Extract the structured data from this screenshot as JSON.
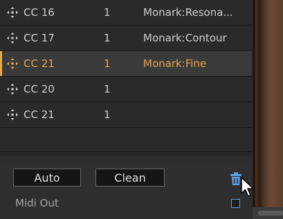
{
  "rows": [
    {
      "cc": "CC 16",
      "channel": "1",
      "param": "Monark:Resona..."
    },
    {
      "cc": "CC 17",
      "channel": "1",
      "param": "Monark:Contour"
    },
    {
      "cc": "CC 21",
      "channel": "1",
      "param": "Monark:Fine",
      "selected": true
    },
    {
      "cc": "CC 20",
      "channel": "1",
      "param": ""
    },
    {
      "cc": "CC 21",
      "channel": "1",
      "param": ""
    }
  ],
  "toolbar": {
    "auto_label": "Auto",
    "clean_label": "Clean",
    "delete_icon": "trash-icon",
    "midi_out_label": "Midi Out",
    "midi_out_checked": false
  },
  "colors": {
    "selected_text": "#e8a650",
    "accent_blue": "#5aa0e6",
    "text": "#cfcfcf"
  }
}
